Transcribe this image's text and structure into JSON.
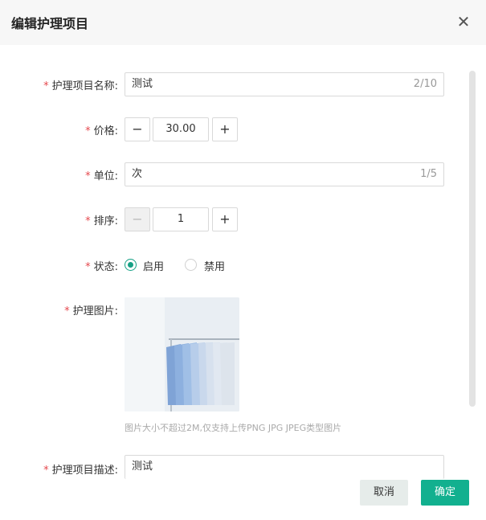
{
  "dialog": {
    "title": "编辑护理项目",
    "close_symbol": "✕"
  },
  "form": {
    "name": {
      "label": "护理项目名称:",
      "value": "测试",
      "counter": "2/10"
    },
    "price": {
      "label": "价格:",
      "value": "30.00",
      "minus": "−",
      "plus": "+"
    },
    "unit": {
      "label": "单位:",
      "value": "次",
      "counter": "1/5"
    },
    "sort": {
      "label": "排序:",
      "value": "1",
      "minus": "−",
      "plus": "+"
    },
    "status": {
      "label": "状态:",
      "options": [
        "启用",
        "禁用"
      ],
      "selected": "启用"
    },
    "image": {
      "label": "护理图片:",
      "hint": "图片大小不超过2M,仅支持上传PNG JPG JPEG类型图片"
    },
    "description": {
      "label": "护理项目描述:",
      "value": "测试"
    },
    "required_mark": "*"
  },
  "footer": {
    "cancel_label": "取消",
    "confirm_label": "确定"
  },
  "colors": {
    "accent": "#12b08f",
    "required": "#e5484d"
  }
}
